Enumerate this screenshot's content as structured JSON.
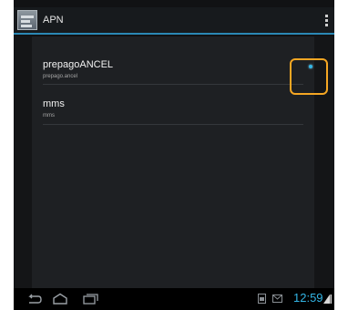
{
  "action_bar": {
    "title": "APN",
    "app_icon": "apn-settings-icon",
    "overflow_icon": "overflow-menu-icon"
  },
  "apn_list": [
    {
      "name": "prepagoANCEL",
      "apn": "prepago.ancel",
      "selected": true
    },
    {
      "name": "mms",
      "apn": "mms",
      "selected": false
    }
  ],
  "navigation_bar": {
    "icons": [
      "back-icon",
      "home-icon",
      "recent-apps-icon"
    ]
  },
  "status": {
    "time": "12:59",
    "icons": [
      "screenshot-notification-icon",
      "email-notification-icon",
      "signal-icon"
    ]
  },
  "colors": {
    "accent": "#33b5e5",
    "highlight": "#f5a623",
    "background": "#1e2023"
  }
}
